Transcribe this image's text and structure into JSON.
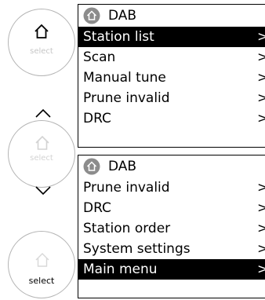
{
  "knobs": {
    "top_label": "select",
    "middle_label": "select",
    "bottom_label": "select"
  },
  "screen1": {
    "title": "DAB",
    "items": [
      {
        "label": "Station list",
        "arrow": ">"
      },
      {
        "label": "Scan",
        "arrow": ">"
      },
      {
        "label": "Manual tune",
        "arrow": ">"
      },
      {
        "label": "Prune invalid",
        "arrow": ">"
      },
      {
        "label": "DRC",
        "arrow": ">"
      }
    ]
  },
  "screen2": {
    "title": "DAB",
    "items": [
      {
        "label": "Prune invalid",
        "arrow": ">"
      },
      {
        "label": "DRC",
        "arrow": ">"
      },
      {
        "label": "Station order",
        "arrow": ">"
      },
      {
        "label": "System settings",
        "arrow": ">"
      },
      {
        "label": "Main menu",
        "arrow": ">"
      }
    ]
  },
  "colors": {
    "highlight": "#000000",
    "knob_border": "#b4b4b4",
    "home_badge": "#8c8c8c"
  }
}
